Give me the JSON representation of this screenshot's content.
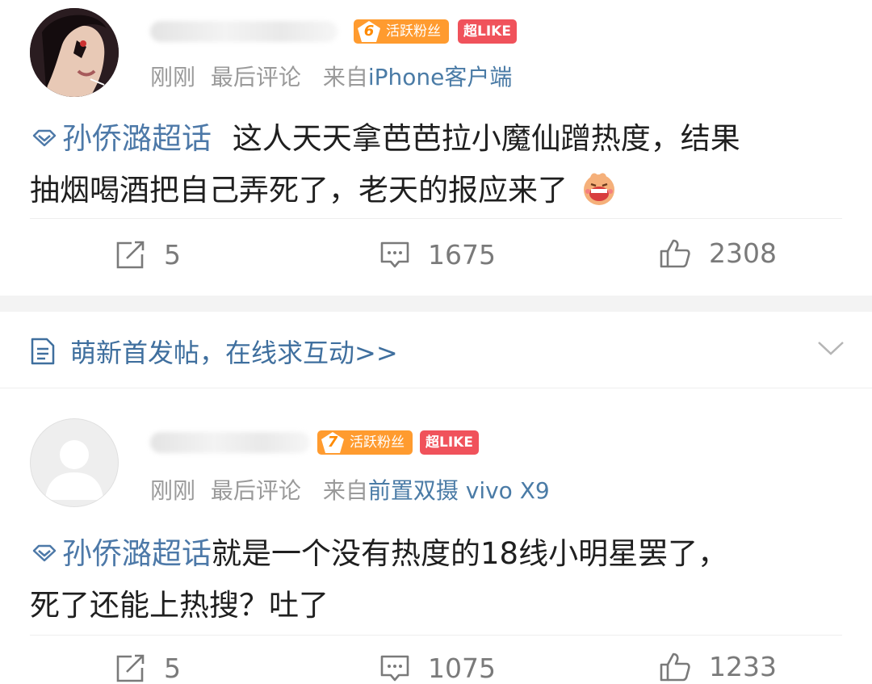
{
  "posts": [
    {
      "badge_level": "6",
      "badge_label": "活跃粉丝",
      "like_badge": "超LIKE",
      "time": "刚刚",
      "activity": "最后评论",
      "from_prefix": "来自",
      "source": "iPhone客户端",
      "topic": "孙侨潞超话",
      "text_line1": "这人天天拿芭芭拉小魔仙蹭热度，结果",
      "text_line2": "抽烟喝酒把自己弄死了，老天的报应来了",
      "reposts": "5",
      "comments": "1675",
      "likes": "2308"
    },
    {
      "badge_level": "7",
      "badge_label": "活跃粉丝",
      "like_badge": "超LIKE",
      "time": "刚刚",
      "activity": "最后评论",
      "from_prefix": "来自",
      "source": "前置双摄 vivo X9",
      "topic": "孙侨潞超话",
      "text_line1": "就是一个没有热度的18线小明星罢了，",
      "text_line2": "死了还能上热搜？吐了",
      "reposts": "5",
      "comments": "1075",
      "likes": "1233"
    }
  ],
  "banner": {
    "text": "萌新首发帖，在线求互动>>"
  },
  "colors": {
    "topic": "#4d79a8",
    "fan_badge": "#ff9b2f",
    "like_badge": "#f0525b",
    "meta": "#9a9a9a",
    "separator": "#f3f3f3"
  }
}
